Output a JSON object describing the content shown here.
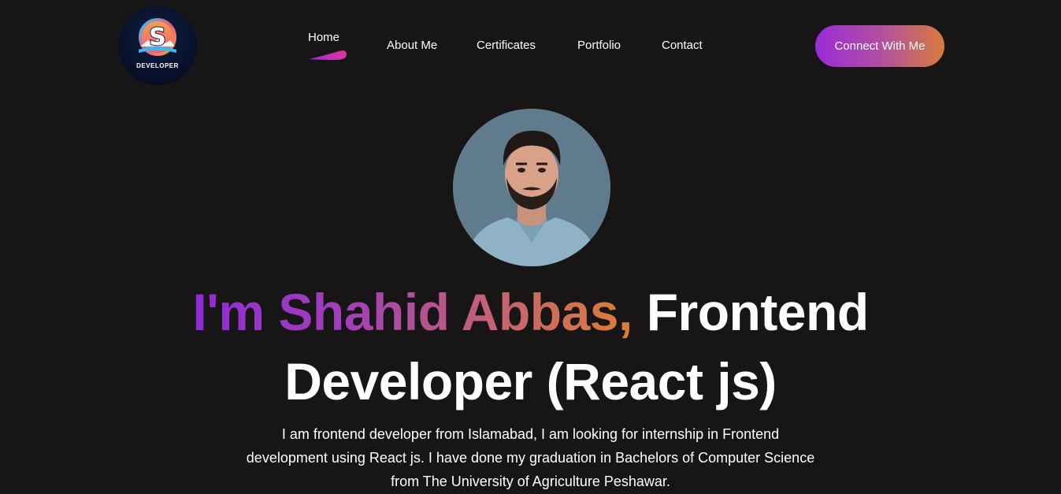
{
  "logo": {
    "letter": "S",
    "caption": "DEVELOPER"
  },
  "nav": {
    "items": [
      {
        "label": "Home",
        "active": true
      },
      {
        "label": "About Me",
        "active": false
      },
      {
        "label": "Certificates",
        "active": false
      },
      {
        "label": "Portfolio",
        "active": false
      },
      {
        "label": "Contact",
        "active": false
      }
    ],
    "cta_label": "Connect With Me"
  },
  "hero": {
    "headline_gradient": "I'm Shahid Abbas,",
    "headline_rest_line1": "Frontend",
    "headline_line2": "Developer (React js)",
    "intro_line1": "I am frontend developer from Islamabad, I am looking for internship in Frontend",
    "intro_line2": "development using React js. I have done my graduation in Bachelors of Computer Science",
    "intro_line3": "from The University of Agriculture Peshawar."
  },
  "colors": {
    "background": "#171515",
    "gradient_start": "#8e2bd6",
    "gradient_end": "#de7d34",
    "text": "#ffffff"
  },
  "icons": {
    "active_nav_indicator": "pink-swoosh-icon",
    "logo": "s-developer-logo-icon",
    "avatar": "profile-photo"
  }
}
